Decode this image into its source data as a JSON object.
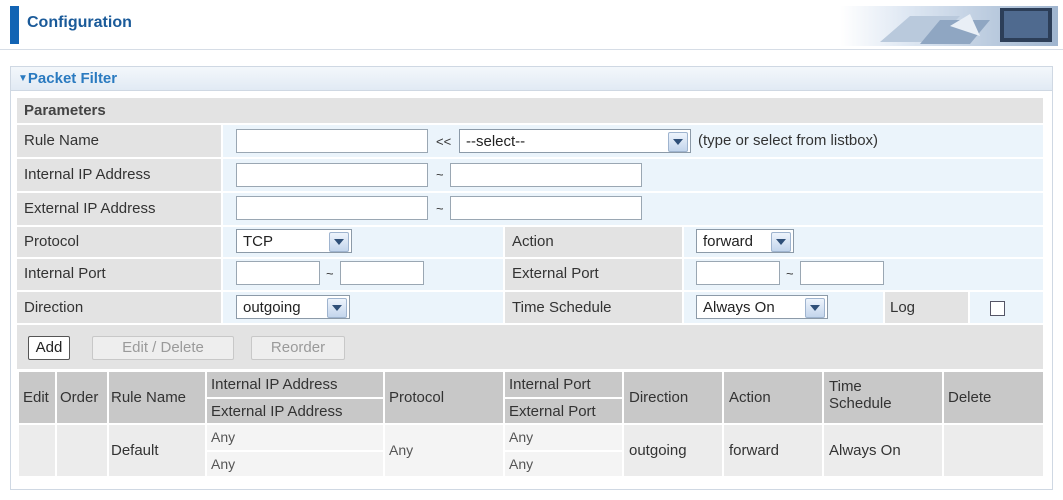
{
  "header": {
    "title": "Configuration"
  },
  "section": {
    "title": "Packet Filter"
  },
  "params": {
    "heading": "Parameters",
    "rule_name_label": "Rule Name",
    "rule_name_value": "",
    "rule_sep": "<<",
    "rule_select": "--select--",
    "rule_hint": "(type or select from listbox)",
    "internal_ip_label": "Internal IP Address",
    "external_ip_label": "External IP Address",
    "range_sep": "~",
    "protocol_label": "Protocol",
    "protocol_value": "TCP",
    "action_label": "Action",
    "action_value": "forward",
    "internal_port_label": "Internal Port",
    "external_port_label": "External Port",
    "direction_label": "Direction",
    "direction_value": "outgoing",
    "time_schedule_label": "Time Schedule",
    "time_schedule_value": "Always On",
    "log_label": "Log",
    "log_checked": false
  },
  "buttons": {
    "add": "Add",
    "edit_delete": "Edit / Delete",
    "reorder": "Reorder"
  },
  "table": {
    "headers": {
      "edit": "Edit",
      "order": "Order",
      "rule_name": "Rule Name",
      "internal_ip": "Internal IP Address",
      "external_ip": "External IP Address",
      "protocol": "Protocol",
      "internal_port": "Internal Port",
      "external_port": "External Port",
      "direction": "Direction",
      "action": "Action",
      "time_schedule": "Time\nSchedule",
      "delete": "Delete"
    },
    "row": {
      "rule_name": "Default",
      "internal_ip": "Any",
      "external_ip": "Any",
      "protocol": "Any",
      "internal_port": "Any",
      "external_port": "Any",
      "direction": "outgoing",
      "action": "forward",
      "time_schedule": "Always On"
    }
  }
}
